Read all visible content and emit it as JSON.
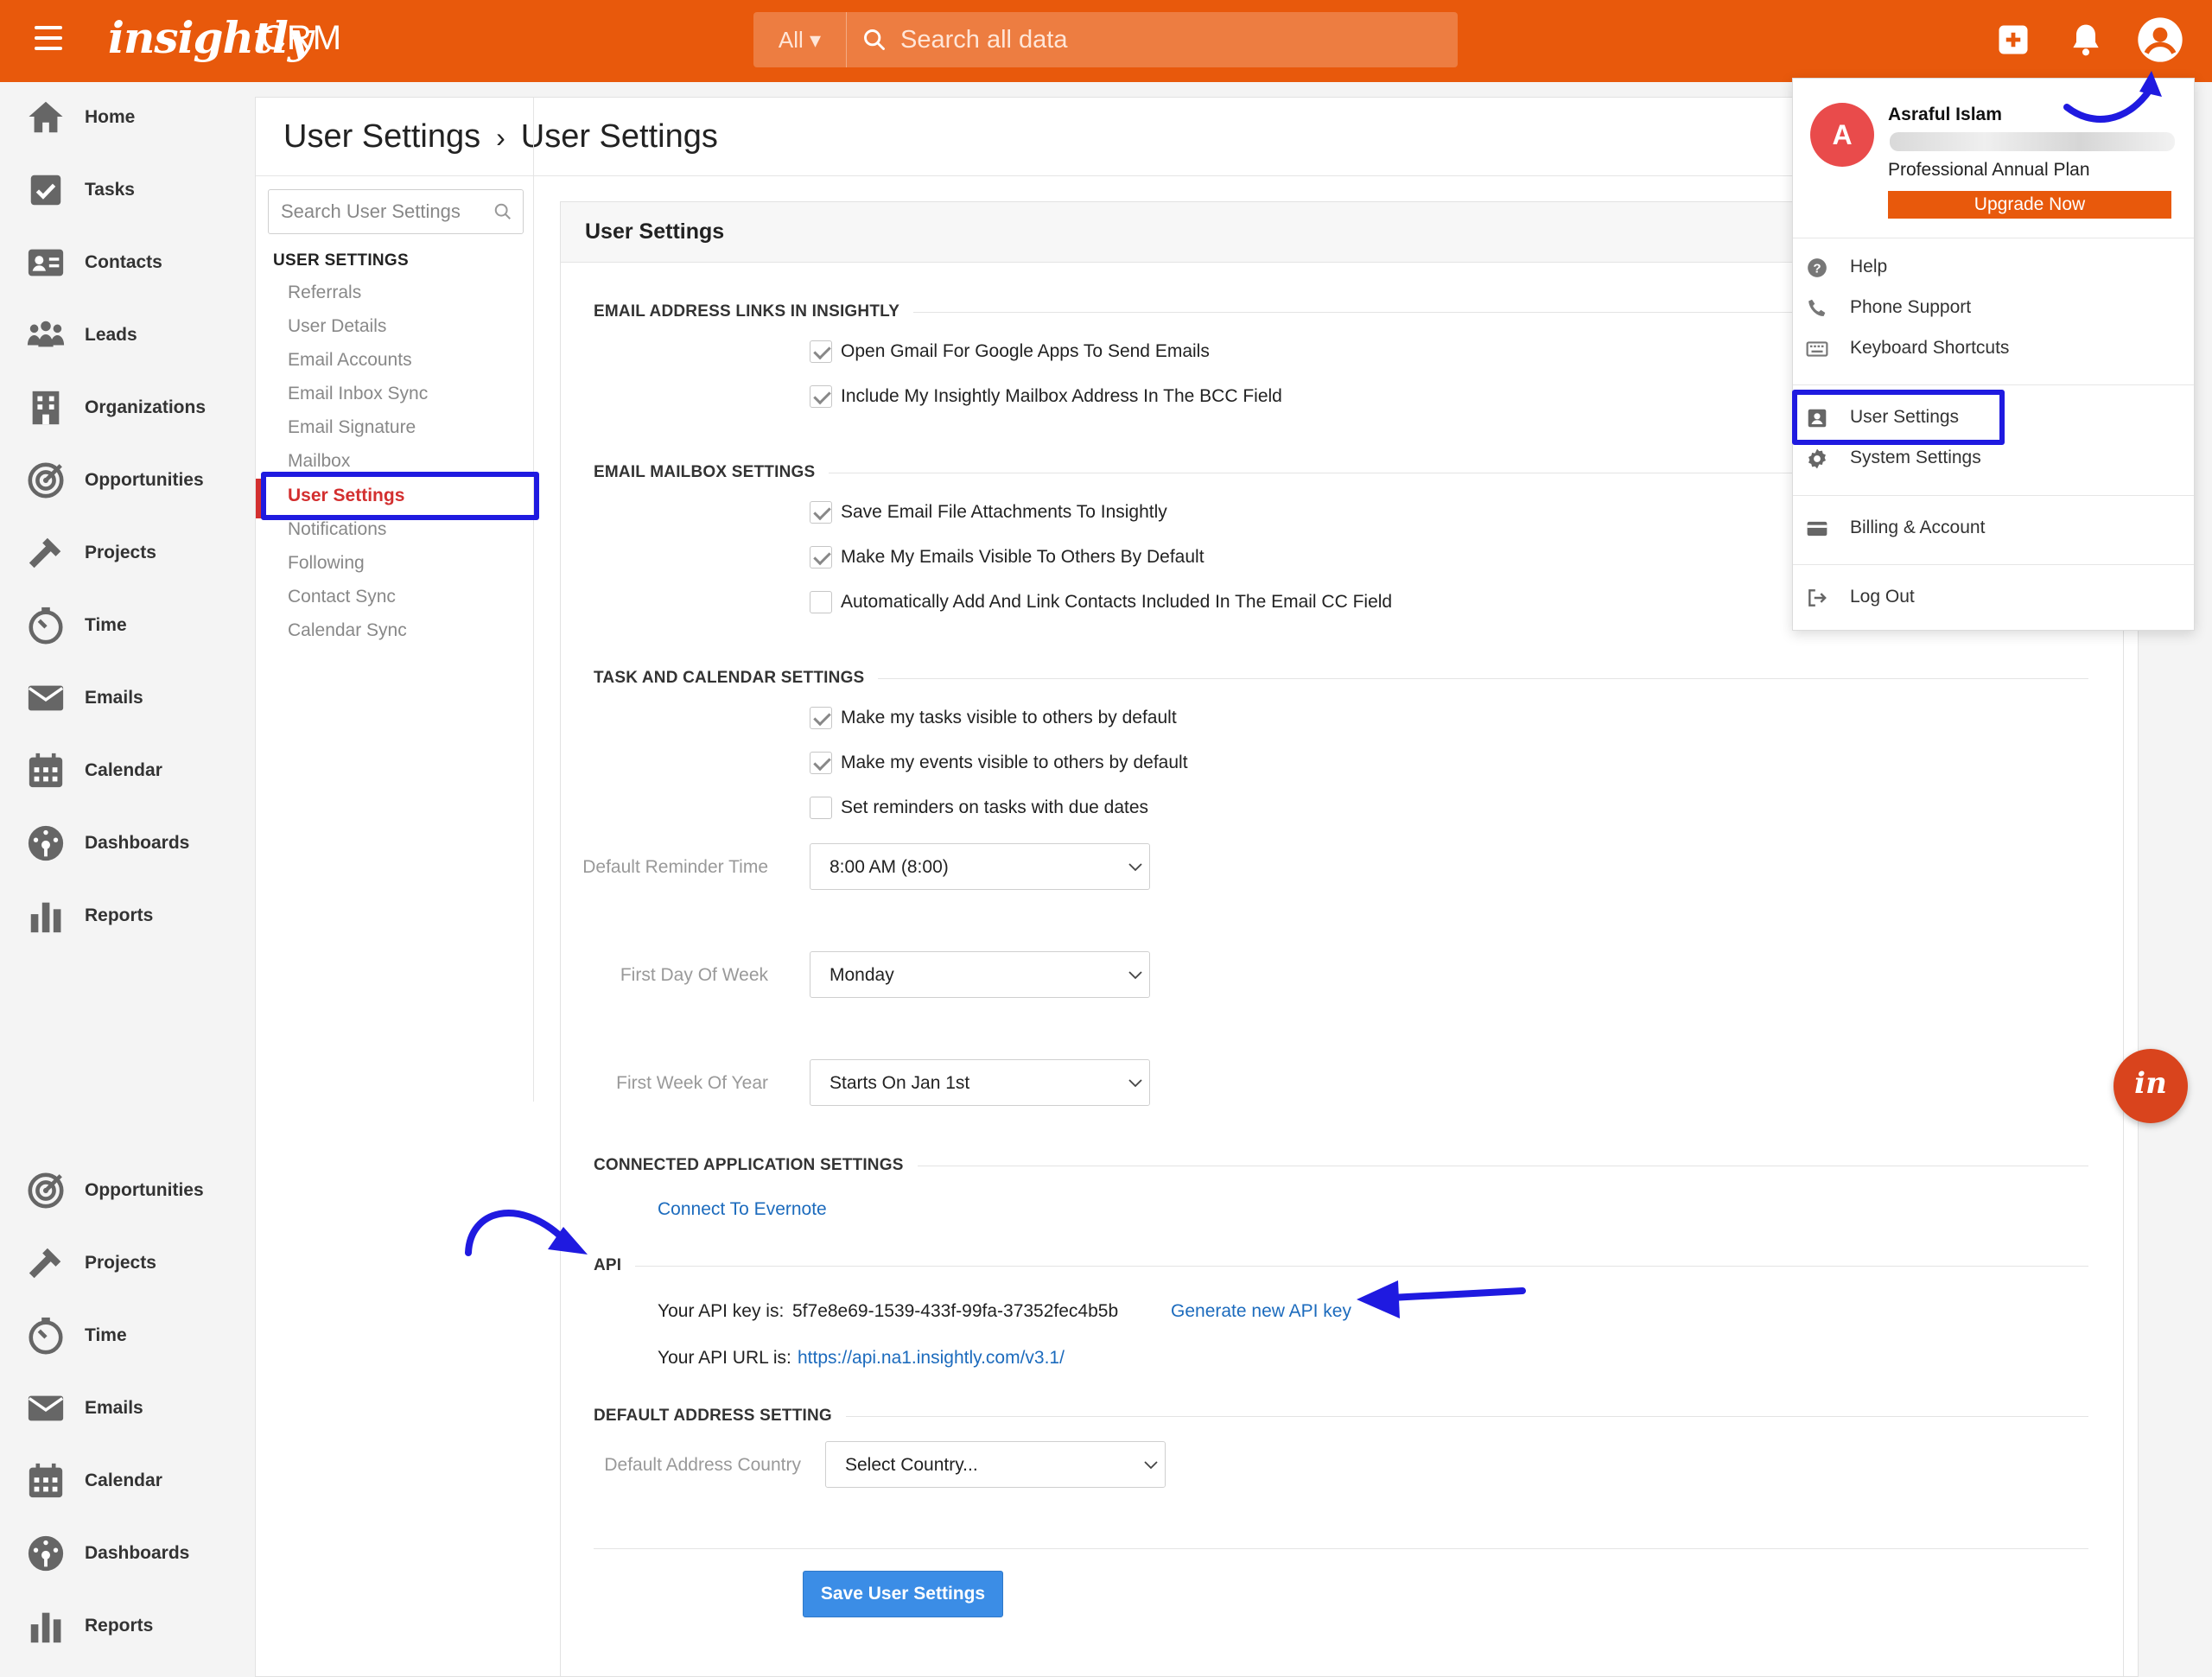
{
  "topbar": {
    "logo": "insightly",
    "product": "CRM",
    "search_scope": "All ▾",
    "search_placeholder": "Search all data",
    "accent": "#e8590c"
  },
  "sidebar": {
    "items": [
      {
        "label": "Home",
        "icon": "home-icon"
      },
      {
        "label": "Tasks",
        "icon": "tasks-icon"
      },
      {
        "label": "Contacts",
        "icon": "contacts-icon"
      },
      {
        "label": "Leads",
        "icon": "leads-icon"
      },
      {
        "label": "Organizations",
        "icon": "organizations-icon"
      },
      {
        "label": "Opportunities",
        "icon": "opportunities-icon"
      },
      {
        "label": "Projects",
        "icon": "projects-icon"
      },
      {
        "label": "Time",
        "icon": "time-icon"
      },
      {
        "label": "Emails",
        "icon": "emails-icon"
      },
      {
        "label": "Calendar",
        "icon": "calendar-icon"
      },
      {
        "label": "Dashboards",
        "icon": "dashboards-icon"
      },
      {
        "label": "Reports",
        "icon": "reports-icon"
      }
    ],
    "items_lower": [
      {
        "label": "Opportunities",
        "icon": "opportunities-icon"
      },
      {
        "label": "Projects",
        "icon": "projects-icon"
      },
      {
        "label": "Time",
        "icon": "time-icon"
      },
      {
        "label": "Emails",
        "icon": "emails-icon"
      },
      {
        "label": "Calendar",
        "icon": "calendar-icon"
      },
      {
        "label": "Dashboards",
        "icon": "dashboards-icon"
      },
      {
        "label": "Reports",
        "icon": "reports-icon"
      }
    ]
  },
  "breadcrumb": {
    "first": "User Settings",
    "separator": "›",
    "second": "User Settings"
  },
  "subnav": {
    "search_placeholder": "Search User Settings",
    "heading": "USER SETTINGS",
    "links": [
      "Referrals",
      "User Details",
      "Email Accounts",
      "Email Inbox Sync",
      "Email Signature",
      "Mailbox",
      "User Settings",
      "Notifications",
      "Following",
      "Contact Sync",
      "Calendar Sync"
    ],
    "active": "User Settings"
  },
  "panel": {
    "title": "User Settings",
    "sections": {
      "email_links": "EMAIL ADDRESS LINKS IN INSIGHTLY",
      "mailbox": "EMAIL MAILBOX SETTINGS",
      "task_calendar": "TASK AND CALENDAR SETTINGS",
      "connected": "CONNECTED APPLICATION SETTINGS",
      "api": "API",
      "default_address": "DEFAULT ADDRESS SETTING"
    },
    "checkboxes": {
      "open_gmail": {
        "label": "Open Gmail For Google Apps To Send Emails",
        "checked": true
      },
      "include_bcc": {
        "label": "Include My Insightly Mailbox Address In The BCC Field",
        "checked": true
      },
      "save_attachments": {
        "label": "Save Email File Attachments To Insightly",
        "checked": true
      },
      "emails_visible": {
        "label": "Make My Emails Visible To Others By Default",
        "checked": true
      },
      "auto_link_cc": {
        "label": "Automatically Add And Link Contacts Included In The Email CC Field",
        "checked": false
      },
      "tasks_visible": {
        "label": "Make my tasks visible to others by default",
        "checked": true
      },
      "events_visible": {
        "label": "Make my events visible to others by default",
        "checked": true
      },
      "reminders": {
        "label": "Set reminders on tasks with due dates",
        "checked": false
      }
    },
    "fields": {
      "reminder_time": {
        "label": "Default Reminder Time",
        "value": "8:00 AM (8:00)"
      },
      "first_day": {
        "label": "First Day Of Week",
        "value": "Monday"
      },
      "first_week": {
        "label": "First Week Of Year",
        "value": "Starts On Jan 1st"
      },
      "address_country": {
        "label": "Default Address Country",
        "value": "Select Country..."
      }
    },
    "connect_evernote": "Connect To Evernote",
    "api": {
      "key_label": "Your API key is:",
      "key_value": "5f7e8e69-1539-433f-99fa-37352fec4b5b",
      "generate_label": "Generate new API key",
      "url_label": "Your API URL is:",
      "url_value": "https://api.na1.insightly.com/v3.1/"
    },
    "save_button": "Save User Settings"
  },
  "dropdown": {
    "avatar_letter": "A",
    "user_name": "Asraful Islam",
    "plan": "Professional Annual Plan",
    "upgrade": "Upgrade Now",
    "items": {
      "help": "Help",
      "phone": "Phone Support",
      "keyboard": "Keyboard Shortcuts",
      "user_settings": "User Settings",
      "system_settings": "System Settings",
      "billing": "Billing & Account",
      "logout": "Log Out"
    }
  },
  "chat": {
    "label": "in"
  },
  "annotation_color": "#1f1ae0"
}
